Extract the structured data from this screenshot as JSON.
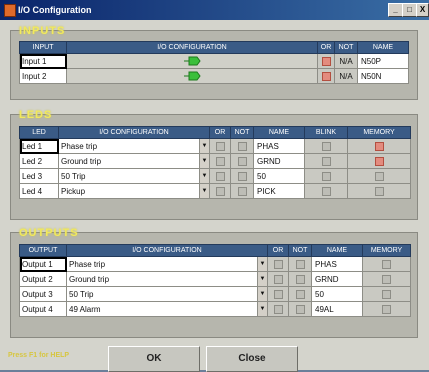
{
  "window": {
    "title": "I/O Configuration",
    "buttons": [
      "_",
      "□",
      "X"
    ]
  },
  "inputs": {
    "section_title": "INPUTS",
    "headers": [
      "INPUT",
      "I/O CONFIGURATION",
      "OR",
      "NOT",
      "NAME"
    ],
    "rows": [
      {
        "label": "Input 1",
        "config_icon": "green-connector-icon",
        "or_checked": true,
        "not": "N/A",
        "name": "N50P"
      },
      {
        "label": "Input 2",
        "config_icon": "green-connector-icon",
        "or_checked": true,
        "not": "N/A",
        "name": "N50N"
      }
    ]
  },
  "leds": {
    "section_title": "LEDS",
    "headers": [
      "LED",
      "I/O CONFIGURATION",
      "OR",
      "NOT",
      "NAME",
      "BLINK",
      "MEMORY"
    ],
    "rows": [
      {
        "label": "Led 1",
        "config": "Phase trip",
        "name": "PHAS",
        "memory_checked": true
      },
      {
        "label": "Led 2",
        "config": "Ground trip",
        "name": "GRND",
        "memory_checked": true
      },
      {
        "label": "Led 3",
        "config": "50 Trip",
        "name": "50",
        "memory_checked": false
      },
      {
        "label": "Led 4",
        "config": "Pickup",
        "name": "PICK",
        "memory_checked": false
      }
    ]
  },
  "outputs": {
    "section_title": "OUTPUTS",
    "headers": [
      "OUTPUT",
      "I/O CONFIGURATION",
      "OR",
      "NOT",
      "NAME",
      "MEMORY"
    ],
    "rows": [
      {
        "label": "Output 1",
        "config": "Phase trip",
        "name": "PHAS"
      },
      {
        "label": "Output 2",
        "config": "Ground trip",
        "name": "GRND"
      },
      {
        "label": "Output 3",
        "config": "50 Trip",
        "name": "50"
      },
      {
        "label": "Output 4",
        "config": "49 Alarm",
        "name": "49AL"
      }
    ]
  },
  "footer": {
    "help": "Press F1 for HELP",
    "ok_label": "OK",
    "close_label": "Close"
  },
  "colors": {
    "title_accent": "#f1e95c",
    "header_bg": "#3a5b86",
    "checked_red": "#e38b7e",
    "plug_green": "#3bbf3b"
  }
}
